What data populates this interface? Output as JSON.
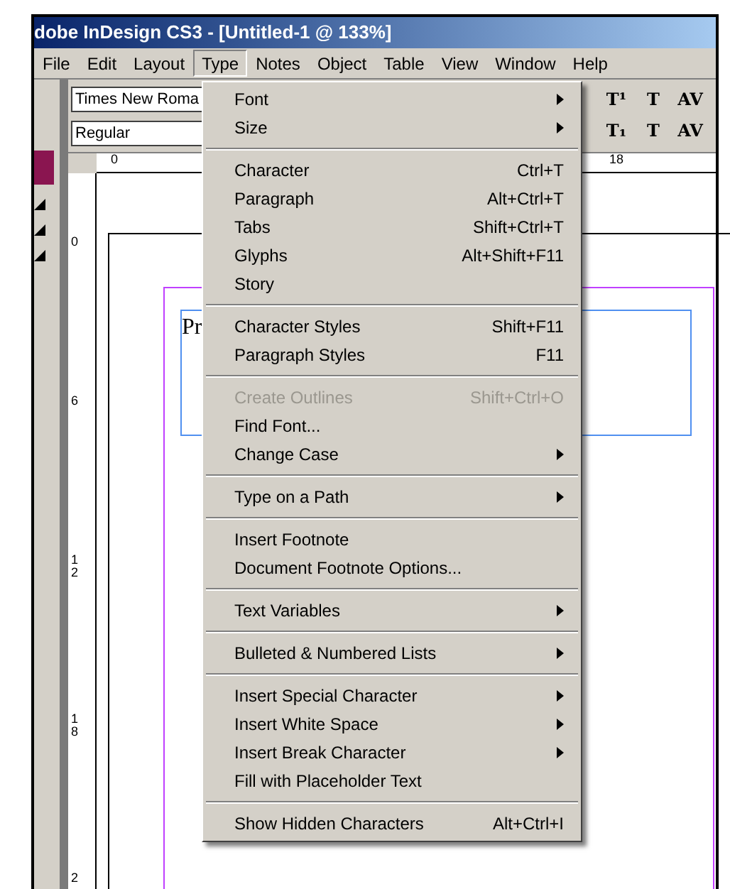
{
  "window": {
    "title": "dobe InDesign CS3 - [Untitled-1 @ 133%]"
  },
  "menubar": [
    {
      "label": "File",
      "selected": false
    },
    {
      "label": "Edit",
      "selected": false
    },
    {
      "label": "Layout",
      "selected": false
    },
    {
      "label": "Type",
      "selected": true
    },
    {
      "label": "Notes",
      "selected": false
    },
    {
      "label": "Object",
      "selected": false
    },
    {
      "label": "Table",
      "selected": false
    },
    {
      "label": "View",
      "selected": false
    },
    {
      "label": "Window",
      "selected": false
    },
    {
      "label": "Help",
      "selected": false
    }
  ],
  "toolbar": {
    "font_family": "Times New Roma",
    "font_style": "Regular",
    "format_buttons": [
      [
        "T¹",
        "T",
        "AV"
      ],
      [
        "T₁",
        "T",
        "AV"
      ]
    ]
  },
  "ruler": {
    "top_labels": [
      "0",
      "18"
    ],
    "side_labels": [
      "0",
      "6",
      "12",
      "18",
      "2"
    ]
  },
  "document": {
    "text": "Pr"
  },
  "menu": [
    {
      "kind": "item",
      "label": "Font",
      "submenu": true,
      "disabled": false
    },
    {
      "kind": "item",
      "label": "Size",
      "submenu": true,
      "disabled": false
    },
    {
      "kind": "separator"
    },
    {
      "kind": "item",
      "label": "Character",
      "shortcut": "Ctrl+T",
      "submenu": false,
      "disabled": false
    },
    {
      "kind": "item",
      "label": "Paragraph",
      "shortcut": "Alt+Ctrl+T",
      "submenu": false,
      "disabled": false
    },
    {
      "kind": "item",
      "label": "Tabs",
      "shortcut": "Shift+Ctrl+T",
      "submenu": false,
      "disabled": false
    },
    {
      "kind": "item",
      "label": "Glyphs",
      "shortcut": "Alt+Shift+F11",
      "submenu": false,
      "disabled": false
    },
    {
      "kind": "item",
      "label": "Story",
      "submenu": false,
      "disabled": false
    },
    {
      "kind": "separator"
    },
    {
      "kind": "item",
      "label": "Character Styles",
      "shortcut": "Shift+F11",
      "submenu": false,
      "disabled": false
    },
    {
      "kind": "item",
      "label": "Paragraph Styles",
      "shortcut": "F11",
      "submenu": false,
      "disabled": false
    },
    {
      "kind": "separator"
    },
    {
      "kind": "item",
      "label": "Create Outlines",
      "shortcut": "Shift+Ctrl+O",
      "submenu": false,
      "disabled": true
    },
    {
      "kind": "item",
      "label": "Find Font...",
      "submenu": false,
      "disabled": false
    },
    {
      "kind": "item",
      "label": "Change Case",
      "submenu": true,
      "disabled": false
    },
    {
      "kind": "separator"
    },
    {
      "kind": "item",
      "label": "Type on a Path",
      "submenu": true,
      "disabled": false
    },
    {
      "kind": "separator"
    },
    {
      "kind": "item",
      "label": "Insert Footnote",
      "submenu": false,
      "disabled": false
    },
    {
      "kind": "item",
      "label": "Document Footnote Options...",
      "submenu": false,
      "disabled": false
    },
    {
      "kind": "separator"
    },
    {
      "kind": "item",
      "label": "Text Variables",
      "submenu": true,
      "disabled": false
    },
    {
      "kind": "separator"
    },
    {
      "kind": "item",
      "label": "Bulleted & Numbered Lists",
      "submenu": true,
      "disabled": false
    },
    {
      "kind": "separator"
    },
    {
      "kind": "item",
      "label": "Insert Special Character",
      "submenu": true,
      "disabled": false
    },
    {
      "kind": "item",
      "label": "Insert White Space",
      "submenu": true,
      "disabled": false
    },
    {
      "kind": "item",
      "label": "Insert Break Character",
      "submenu": true,
      "disabled": false
    },
    {
      "kind": "item",
      "label": "Fill with Placeholder Text",
      "submenu": false,
      "disabled": false
    },
    {
      "kind": "separator"
    },
    {
      "kind": "item",
      "label": "Show Hidden Characters",
      "shortcut": "Alt+Ctrl+I",
      "submenu": false,
      "disabled": false
    }
  ]
}
